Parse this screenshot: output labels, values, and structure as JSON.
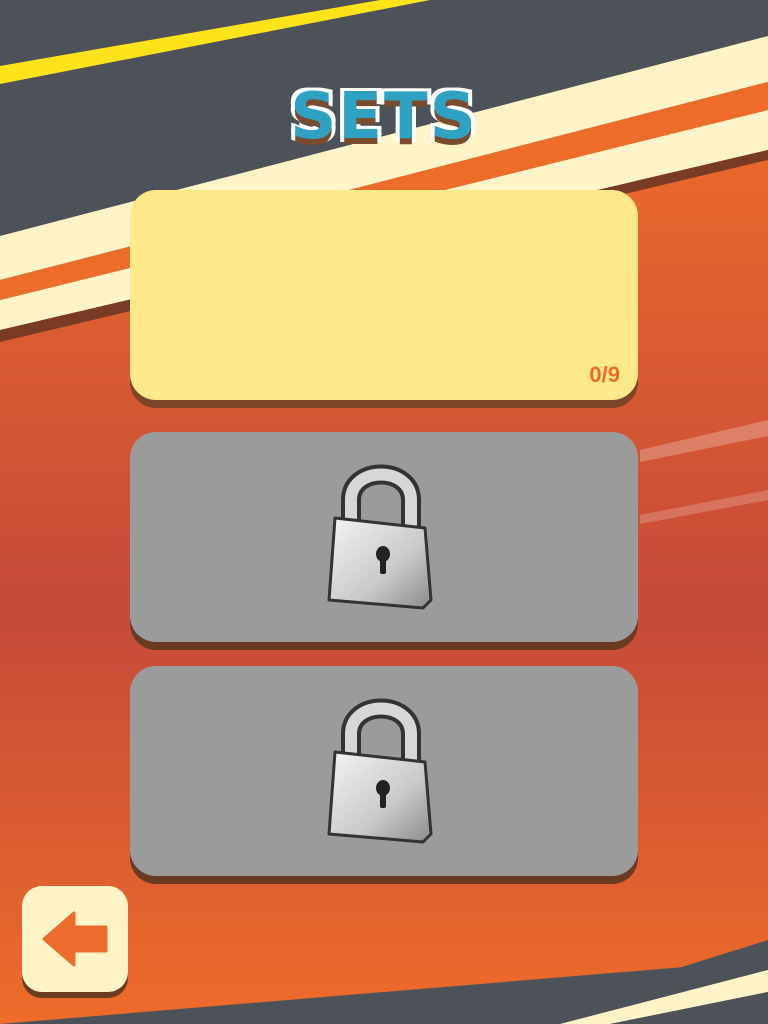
{
  "screen": {
    "title": "SETS"
  },
  "sets": [
    {
      "state": "unlocked",
      "progress": "0/9",
      "color": "#fde88a"
    },
    {
      "state": "locked",
      "icon": "padlock-icon",
      "color": "#9b9b9b"
    },
    {
      "state": "locked",
      "icon": "padlock-icon",
      "color": "#9b9b9b"
    }
  ],
  "back_button": {
    "icon": "back-arrow-icon"
  },
  "colors": {
    "title_fill": "#2fa2c3",
    "accent_orange": "#ec6b2d",
    "stripe_yellow": "#ffe21a",
    "stripe_cream": "#fff4c8",
    "asphalt": "#4d5158"
  }
}
